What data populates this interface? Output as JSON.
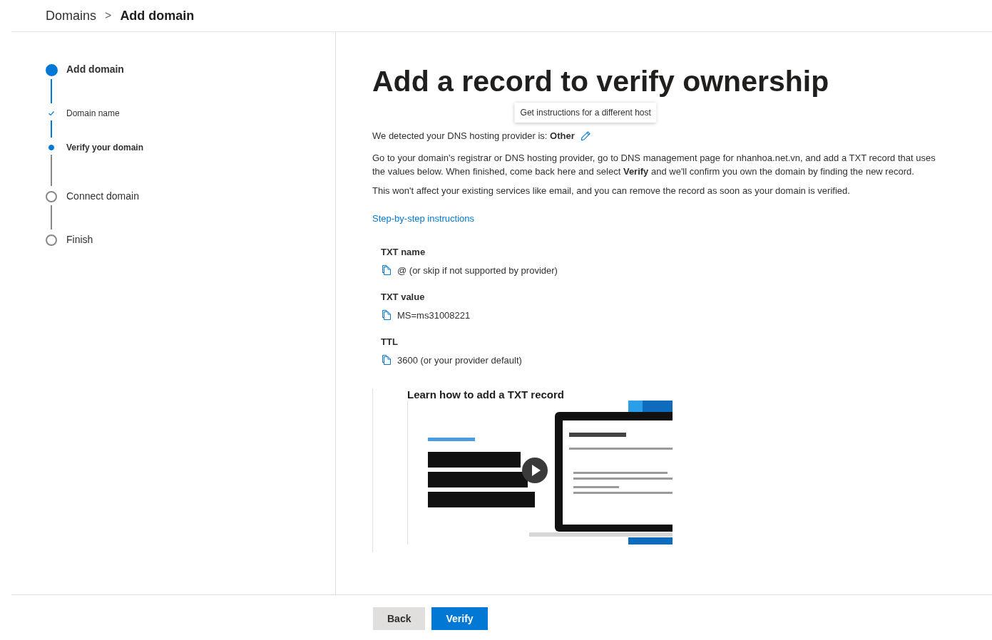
{
  "breadcrumb": {
    "parent": "Domains",
    "separator": ">",
    "current": "Add domain"
  },
  "steps": [
    {
      "label": "Add domain",
      "kind": "major",
      "current": true,
      "done": false
    },
    {
      "label": "Domain name",
      "kind": "minor",
      "current": false,
      "done": true
    },
    {
      "label": "Verify your domain",
      "kind": "minor",
      "current": true,
      "done": false
    },
    {
      "label": "Connect domain",
      "kind": "major",
      "current": false,
      "done": false
    },
    {
      "label": "Finish",
      "kind": "major",
      "current": false,
      "done": false
    }
  ],
  "title": "Add a record to verify ownership",
  "tooltip": "Get instructions for a different host",
  "detected": "We detected your DNS hosting provider is: **Other**",
  "paragraphs": [
    "Go to your domain's registrar or DNS hosting provider, go to DNS management page for nhanhoa.net.vn, and add a TXT record that uses the values below. When finished, come back here and select **Verify** and we'll confirm you own the domain by finding the new record.",
    "This won't affect your existing services like email, and you can remove the record as soon as your domain is verified."
  ],
  "instructions_link": "Step-by-step instructions",
  "records": [
    {
      "label": "TXT name",
      "value": "@ (or skip if not supported by provider)"
    },
    {
      "label": "TXT value",
      "value": "MS=ms31008221"
    },
    {
      "label": "TTL",
      "value": "3600 (or your provider default)"
    }
  ],
  "video": {
    "heading": "Learn how to add a TXT record",
    "kind": "picture"
  },
  "buttons": [
    {
      "label": "Back",
      "kind": "secondary"
    },
    {
      "label": "Verify",
      "kind": "primary"
    }
  ]
}
